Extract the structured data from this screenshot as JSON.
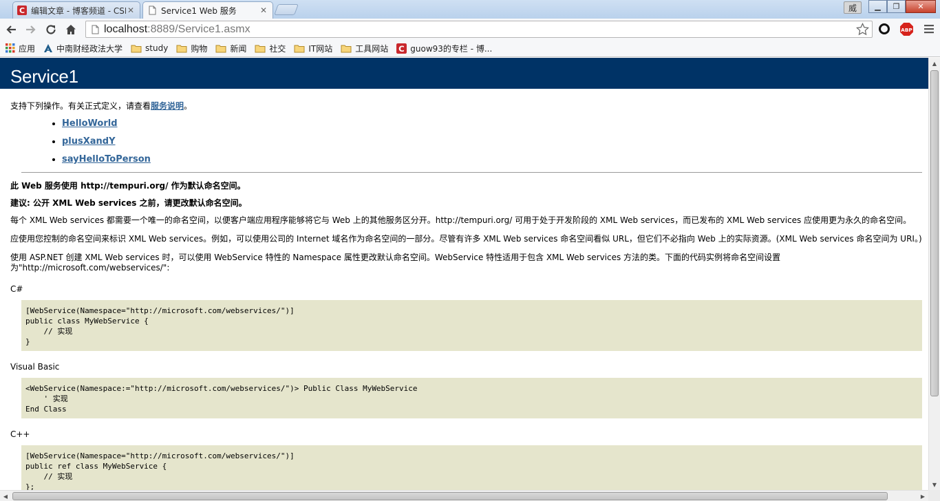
{
  "browser": {
    "tabs": [
      {
        "title": "编辑文章 - 博客频道 - CSI",
        "active": false
      },
      {
        "title": "Service1 Web 服务",
        "active": true
      }
    ],
    "profile_badge": "威",
    "address": {
      "host": "localhost",
      "rest": ":8889/Service1.asmx"
    },
    "extensions": [
      "circle-extension",
      "adblock-plus"
    ],
    "abp_label": "ABP",
    "bookmarks": [
      {
        "label": "应用",
        "icon": "apps-grid-icon"
      },
      {
        "label": "中南财经政法大学",
        "icon": "school-logo-icon"
      },
      {
        "label": "study",
        "icon": "folder-icon"
      },
      {
        "label": "购物",
        "icon": "folder-icon"
      },
      {
        "label": "新闻",
        "icon": "folder-icon"
      },
      {
        "label": "社交",
        "icon": "folder-icon"
      },
      {
        "label": "IT网站",
        "icon": "folder-icon"
      },
      {
        "label": "工具网站",
        "icon": "folder-icon"
      },
      {
        "label": "guow93的专栏 - 博...",
        "icon": "csdn-icon"
      }
    ],
    "colors": {
      "csdn_red": "#c9282d",
      "abp_red": "#d6231c",
      "header_navy": "#003366",
      "code_bg": "#e5e5cc",
      "link": "#336699"
    }
  },
  "page": {
    "title": "Service1",
    "intro": {
      "text": "支持下列操作。有关正式定义，请查看",
      "link": "服务说明",
      "end": "。"
    },
    "operations": [
      "HelloWorld",
      "plusXandY",
      "sayHelloToPerson"
    ],
    "notice1": "此 Web 服务使用 http://tempuri.org/ 作为默认命名空间。",
    "notice2": "建议: 公开 XML Web services 之前，请更改默认命名空间。",
    "para1": "每个 XML Web services 都需要一个唯一的命名空间，以便客户端应用程序能够将它与 Web 上的其他服务区分开。http://tempuri.org/ 可用于处于开发阶段的 XML Web services，而已发布的 XML Web services 应使用更为永久的命名空间。",
    "para2": "应使用您控制的命名空间来标识 XML Web services。例如，可以使用公司的 Internet 域名作为命名空间的一部分。尽管有许多 XML Web services 命名空间看似 URL，但它们不必指向 Web 上的实际资源。(XML Web services 命名空间为 URI。)",
    "para3": "使用 ASP.NET 创建 XML Web services 时，可以使用 WebService 特性的 Namespace 属性更改默认命名空间。WebService 特性适用于包含 XML Web services 方法的类。下面的代码实例将命名空间设置为\"http://microsoft.com/webservices/\":",
    "samples": [
      {
        "lang": "C#",
        "code": "[WebService(Namespace=\"http://microsoft.com/webservices/\")]\npublic class MyWebService {\n    // 实现\n}"
      },
      {
        "lang": "Visual Basic",
        "code": "<WebService(Namespace:=\"http://microsoft.com/webservices/\")> Public Class MyWebService\n    ' 实现\nEnd Class"
      },
      {
        "lang": "C++",
        "code": "[WebService(Namespace=\"http://microsoft.com/webservices/\")]\npublic ref class MyWebService {\n    // 实现\n};"
      }
    ]
  }
}
